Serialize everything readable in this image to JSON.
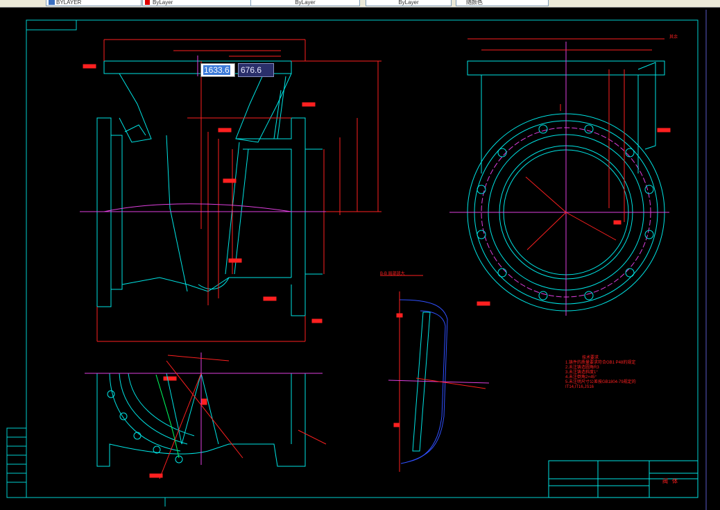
{
  "toolbar": {
    "layer_combo": "BYLAYER",
    "color_combo": "ByLayer",
    "linetype_combo": "ByLayer",
    "lineweight_combo": "ByLayer",
    "plotstyle_combo": "随颜色"
  },
  "dynamic_input": {
    "x_value": "1633.6",
    "y_value": "676.6"
  },
  "notes": {
    "title": "技术要求",
    "lines": [
      "1.铸件的质量要求符合GB1 P48的规定",
      "2.未注铸造圆角R3",
      "3.未注铸造斜度1°",
      "4.未注倒角2×45°",
      "5.未注明尺寸公差按GB1804-79规定的",
      "IT14,IT16,JS16"
    ]
  },
  "section_label": "B-B 局部放大",
  "title_block": {
    "part_name": "阀体"
  },
  "colors": {
    "outline": "#00e5e5",
    "dimension": "#ff2020",
    "centerline": "#e040e0",
    "hidden": "#3050ff",
    "accent": "#00ff60"
  }
}
